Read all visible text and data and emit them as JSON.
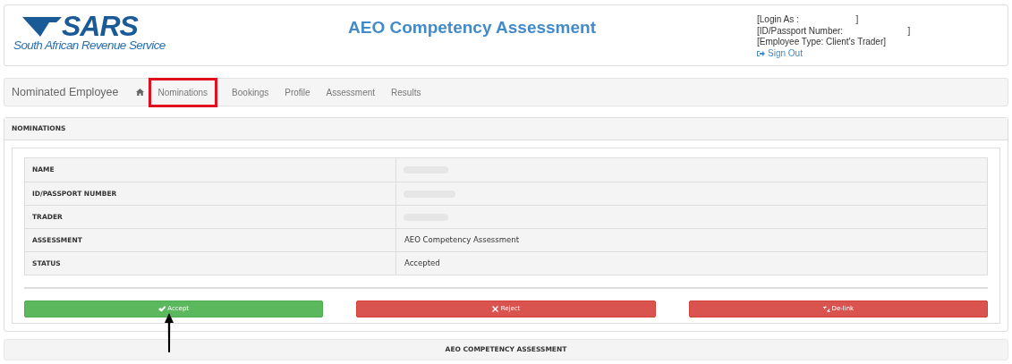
{
  "header": {
    "logo": {
      "name": "SARS",
      "subtitle": "South African Revenue Service"
    },
    "title": "AEO Competency Assessment",
    "user_info": [
      "[Login As :                       ]",
      "[ID/Passport Number:                          ]",
      "[Employee Type: Client's Trader]"
    ],
    "sign_out": "Sign Out"
  },
  "nav": {
    "brand": "Nominated Employee",
    "items": [
      {
        "label": "Nominations",
        "highlighted": true
      },
      {
        "label": "Bookings",
        "highlighted": false
      },
      {
        "label": "Profile",
        "highlighted": false
      },
      {
        "label": "Assessment",
        "highlighted": false
      },
      {
        "label": "Results",
        "highlighted": false
      }
    ]
  },
  "nominations": {
    "title": "NOMINATIONS",
    "rows": [
      {
        "label": "NAME"
      },
      {
        "label": "ID/PASSPORT NUMBER"
      },
      {
        "label": "TRADER"
      },
      {
        "label": "ASSESSMENT",
        "value": "AEO Competency Assessment"
      },
      {
        "label": "STATUS",
        "value": "Accepted"
      }
    ],
    "buttons": [
      {
        "kind": "accept",
        "label": "Accept"
      },
      {
        "kind": "reject",
        "label": "Reject"
      },
      {
        "kind": "delink",
        "label": "De-link"
      }
    ]
  },
  "annotations": [
    {
      "kind": "arrow"
    }
  ],
  "footer_panel": {
    "title": "AEO COMPETENCY ASSESSMENT"
  }
}
